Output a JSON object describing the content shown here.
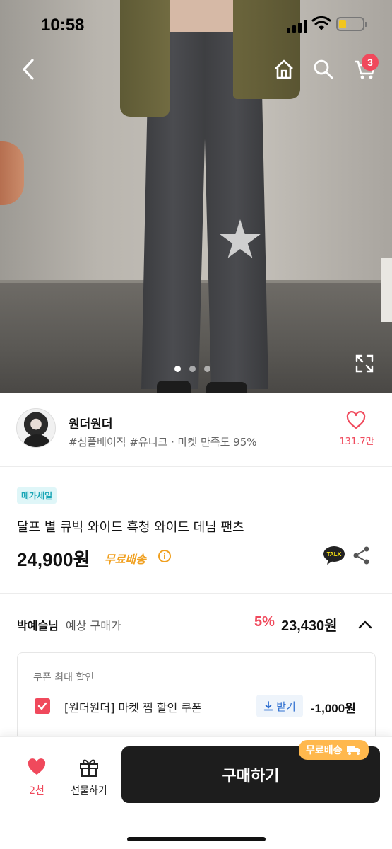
{
  "status": {
    "time": "10:58",
    "battery_color": "#f2c61f"
  },
  "header": {
    "cart_count": "3"
  },
  "gallery": {
    "page_count": 3,
    "active_index": 0
  },
  "shop": {
    "name": "원더원더",
    "meta": "#심플베이직 #유니크 · 마켓 만족도 95%",
    "likes": "131.7만"
  },
  "product": {
    "badge": "메가세일",
    "title": "달프 별 큐빅 와이드 흑청 와이드 데님 팬츠",
    "price": "24,900원",
    "shipping": "무료배송",
    "talk_label": "TALK"
  },
  "expected": {
    "user": "박예슬님",
    "label": "예상 구매가",
    "discount": "5%",
    "price": "23,430원"
  },
  "coupon": {
    "heading": "쿠폰 최대 할인",
    "name": "[원더원더] 마켓 찜 할인 쿠폰",
    "get_label": "받기",
    "amount": "-1,000원"
  },
  "bottom": {
    "wish_count": "2천",
    "gift_label": "선물하기",
    "buy_label": "구매하기",
    "buy_badge": "무료배송"
  },
  "colors": {
    "accent": "#f0495c",
    "orange": "#f0a020",
    "dark_button": "#1d1d1d"
  }
}
